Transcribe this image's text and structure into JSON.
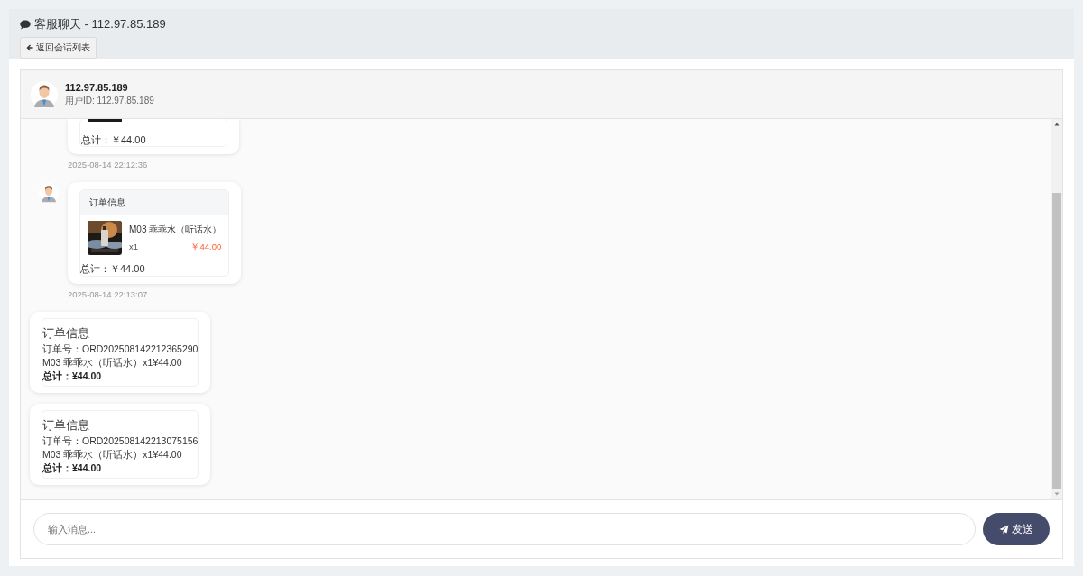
{
  "page": {
    "title": "客服聊天 - 112.97.85.189",
    "back_button": "返回会话列表"
  },
  "chat_header": {
    "name": "112.97.85.189",
    "user_id": "用户ID: 112.97.85.189"
  },
  "messages": [
    {
      "kind": "order_card_clipped",
      "total": "总计：￥44.00",
      "time": "2025-08-14 22:12:36"
    },
    {
      "kind": "order_card",
      "avatar": true,
      "title": "订单信息",
      "product": "M03 乖乖水（听话水）",
      "qty": "x1",
      "price": "￥44.00",
      "total": "总计：￥44.00",
      "time": "2025-08-14 22:13:07"
    },
    {
      "kind": "order_text",
      "avatar": false,
      "title": "订单信息",
      "order_no": "订单号：ORD202508142212365290",
      "item": "M03 乖乖水（听话水）x1¥44.00",
      "total": "总计：¥44.00"
    },
    {
      "kind": "order_text",
      "avatar": false,
      "title": "订单信息",
      "order_no": "订单号：ORD202508142213075156",
      "item": "M03 乖乖水（听话水）x1¥44.00",
      "total": "总计：¥44.00"
    }
  ],
  "composer": {
    "placeholder": "输入消息...",
    "send_button": "发送"
  }
}
